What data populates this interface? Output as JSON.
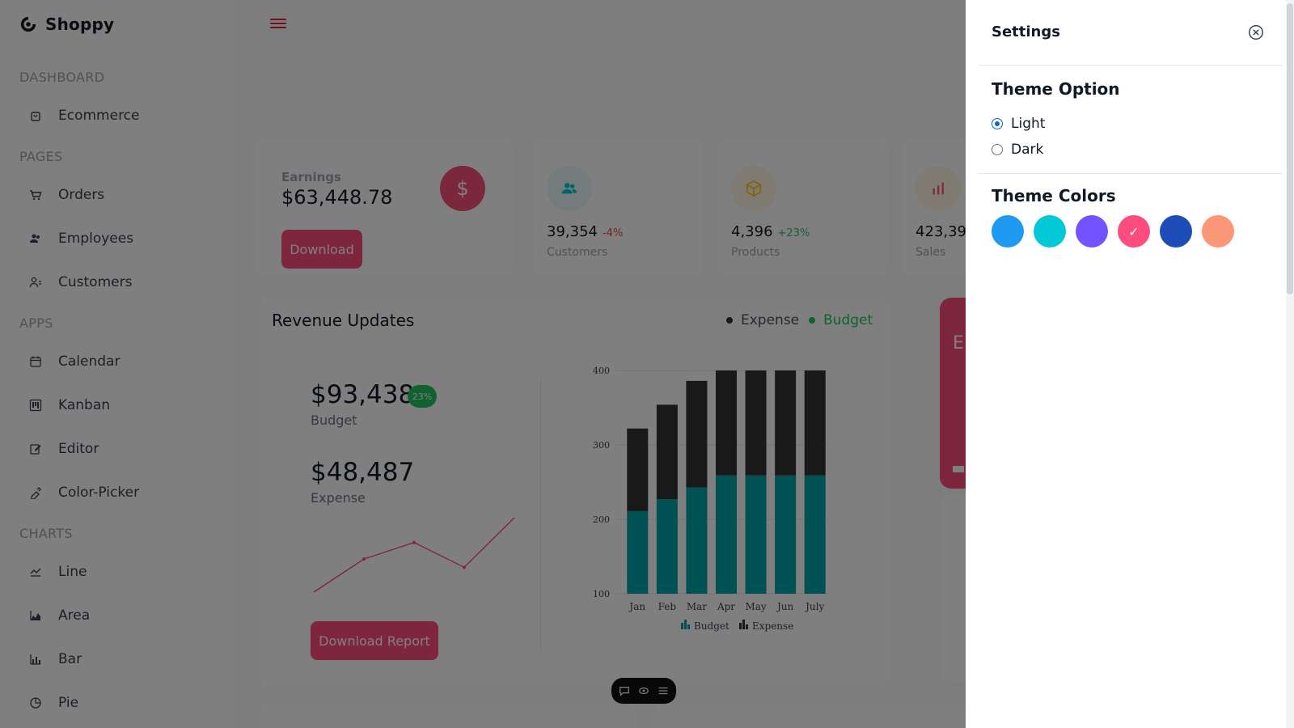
{
  "brand": {
    "name": "Shoppy",
    "logo_icon": "shopping-brand-icon"
  },
  "sidebar": {
    "sections": [
      {
        "title": "DASHBOARD",
        "items": [
          {
            "label": "Ecommerce",
            "icon": "shopping-bag-icon"
          }
        ]
      },
      {
        "title": "PAGES",
        "items": [
          {
            "label": "Orders",
            "icon": "cart-icon"
          },
          {
            "label": "Employees",
            "icon": "users-icon"
          },
          {
            "label": "Customers",
            "icon": "user-icon"
          }
        ]
      },
      {
        "title": "APPS",
        "items": [
          {
            "label": "Calendar",
            "icon": "calendar-icon"
          },
          {
            "label": "Kanban",
            "icon": "kanban-icon"
          },
          {
            "label": "Editor",
            "icon": "edit-icon"
          },
          {
            "label": "Color-Picker",
            "icon": "color-picker-icon"
          }
        ]
      },
      {
        "title": "CHARTS",
        "items": [
          {
            "label": "Line",
            "icon": "line-chart-icon"
          },
          {
            "label": "Area",
            "icon": "area-chart-icon"
          },
          {
            "label": "Bar",
            "icon": "bar-chart-icon"
          },
          {
            "label": "Pie",
            "icon": "pie-chart-icon"
          }
        ]
      }
    ]
  },
  "earnings": {
    "label": "Earnings",
    "value": "$63,448.78",
    "icon_symbol": "$",
    "download_label": "Download"
  },
  "stats": [
    {
      "value": "39,354",
      "pct": "-4%",
      "pct_color": "#ef4444",
      "label": "Customers",
      "icon": "people-icon",
      "icon_bg": "#e6f7f8",
      "icon_color": "#03c9d7"
    },
    {
      "value": "4,396",
      "pct": "+23%",
      "pct_color": "#22c55e",
      "label": "Products",
      "icon": "box-icon",
      "icon_bg": "#fef4e5",
      "icon_color": "#fec90f"
    },
    {
      "value": "423,39",
      "pct": "",
      "pct_color": "#22c55e",
      "label": "Sales",
      "icon": "chart-icon",
      "icon_bg": "#fff4e5",
      "icon_color": "#fd4c7d"
    }
  ],
  "revenue": {
    "title": "Revenue Updates",
    "legend_expense": "Expense",
    "legend_budget": "Budget",
    "budget_amount": "$93,438",
    "budget_badge": "23%",
    "budget_label": "Budget",
    "expense_amount": "$48,487",
    "expense_label": "Expense",
    "download_report_label": "Download Report"
  },
  "sparkline": {
    "values": [
      2.0,
      4.0,
      5.0,
      3.5,
      6.5
    ]
  },
  "chart_data": {
    "type": "bar",
    "stacked": true,
    "categories": [
      "Jan",
      "Feb",
      "Mar",
      "Apr",
      "May",
      "Jun",
      "July"
    ],
    "series": [
      {
        "name": "Budget",
        "values": [
          111,
          127,
          143,
          159,
          159,
          159,
          159
        ],
        "color": "#00a3a8"
      },
      {
        "name": "Expense",
        "values": [
          111,
          127,
          143,
          161,
          161,
          161,
          161
        ],
        "color": "#333333"
      }
    ],
    "ylim": [
      100,
      400
    ],
    "yticks": [
      100,
      200,
      300,
      400
    ],
    "legend_position": "bottom"
  },
  "red_card": {
    "letter": "E"
  },
  "toolbar": {
    "icons": [
      "chat-icon",
      "eye-icon",
      "menu-icon"
    ]
  },
  "settings": {
    "title": "Settings",
    "theme_option_title": "Theme Option",
    "light_label": "Light",
    "dark_label": "Dark",
    "theme_colors_title": "Theme Colors",
    "colors": [
      "#1e9bf0",
      "#03c9d7",
      "#7352ff",
      "#fd4c7d",
      "#1e4db7",
      "#fb9678"
    ],
    "selected_color_index": 3,
    "selected_theme": "Light"
  }
}
